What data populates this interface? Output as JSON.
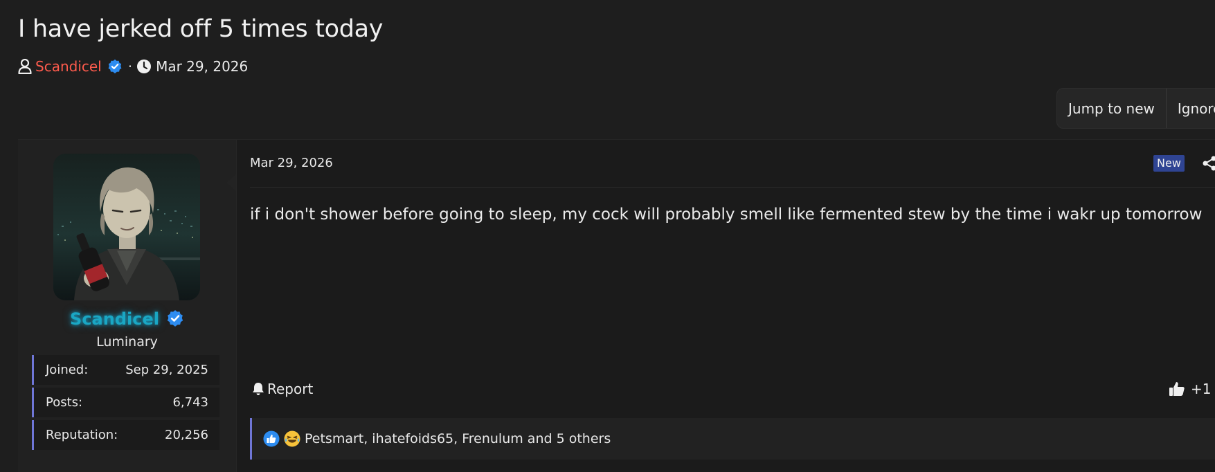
{
  "thread": {
    "title": "I have jerked off 5 times today",
    "author": "Scandicel",
    "separator": "·",
    "date": "Mar 29, 2026"
  },
  "thread_actions": {
    "jump_to_new": "Jump to new",
    "ignore": "Ignore"
  },
  "post": {
    "user": {
      "name": "Scandicel",
      "title": "Luminary",
      "stats": [
        {
          "label": "Joined:",
          "value": "Sep 29, 2025"
        },
        {
          "label": "Posts:",
          "value": "6,743"
        },
        {
          "label": "Reputation:",
          "value": "20,256"
        }
      ]
    },
    "date": "Mar 29, 2026",
    "badge": "New",
    "body": "if i don't shower before going to sleep, my cock will probably smell like fermented stew by the time i wakr up tomorrow",
    "report_label": "Report",
    "like_label": "+1",
    "reactions_text": "Petsmart, ihatefoids65, Frenulum and 5 others"
  },
  "colors": {
    "background": "#1e1e1e",
    "author_link": "#ff5b4d",
    "username_glow": "#1aa7c4",
    "verified": "#2d8cf0",
    "new_badge": "#2f4493",
    "stat_accent": "#6f76d6"
  }
}
